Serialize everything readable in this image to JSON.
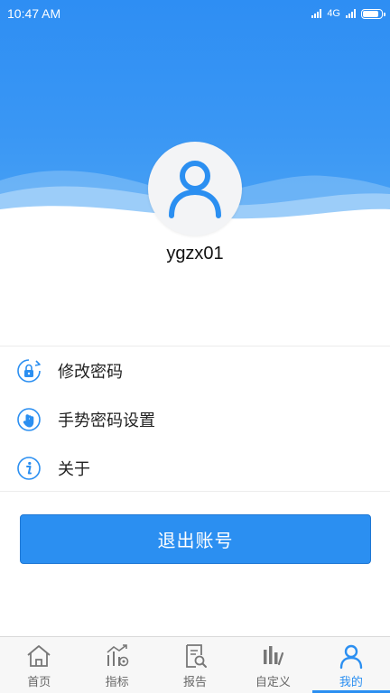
{
  "status_bar": {
    "time": "10:47  AM",
    "network": "4G"
  },
  "profile": {
    "username": "ygzx01"
  },
  "menu": {
    "items": [
      {
        "label": "修改密码",
        "icon": "lock-refresh-icon"
      },
      {
        "label": "手势密码设置",
        "icon": "hand-gesture-icon"
      },
      {
        "label": "关于",
        "icon": "info-icon"
      }
    ]
  },
  "actions": {
    "logout_label": "退出账号"
  },
  "tabbar": {
    "tabs": [
      {
        "label": "首页",
        "icon": "home-icon",
        "active": false
      },
      {
        "label": "指标",
        "icon": "indicator-chart-icon",
        "active": false
      },
      {
        "label": "报告",
        "icon": "report-search-icon",
        "active": false
      },
      {
        "label": "自定义",
        "icon": "custom-bars-icon",
        "active": false
      },
      {
        "label": "我的",
        "icon": "user-icon",
        "active": true
      }
    ]
  },
  "colors": {
    "primary": "#2b8ff1",
    "header_blue": "#3a97f4",
    "inactive_tab": "#666666"
  }
}
